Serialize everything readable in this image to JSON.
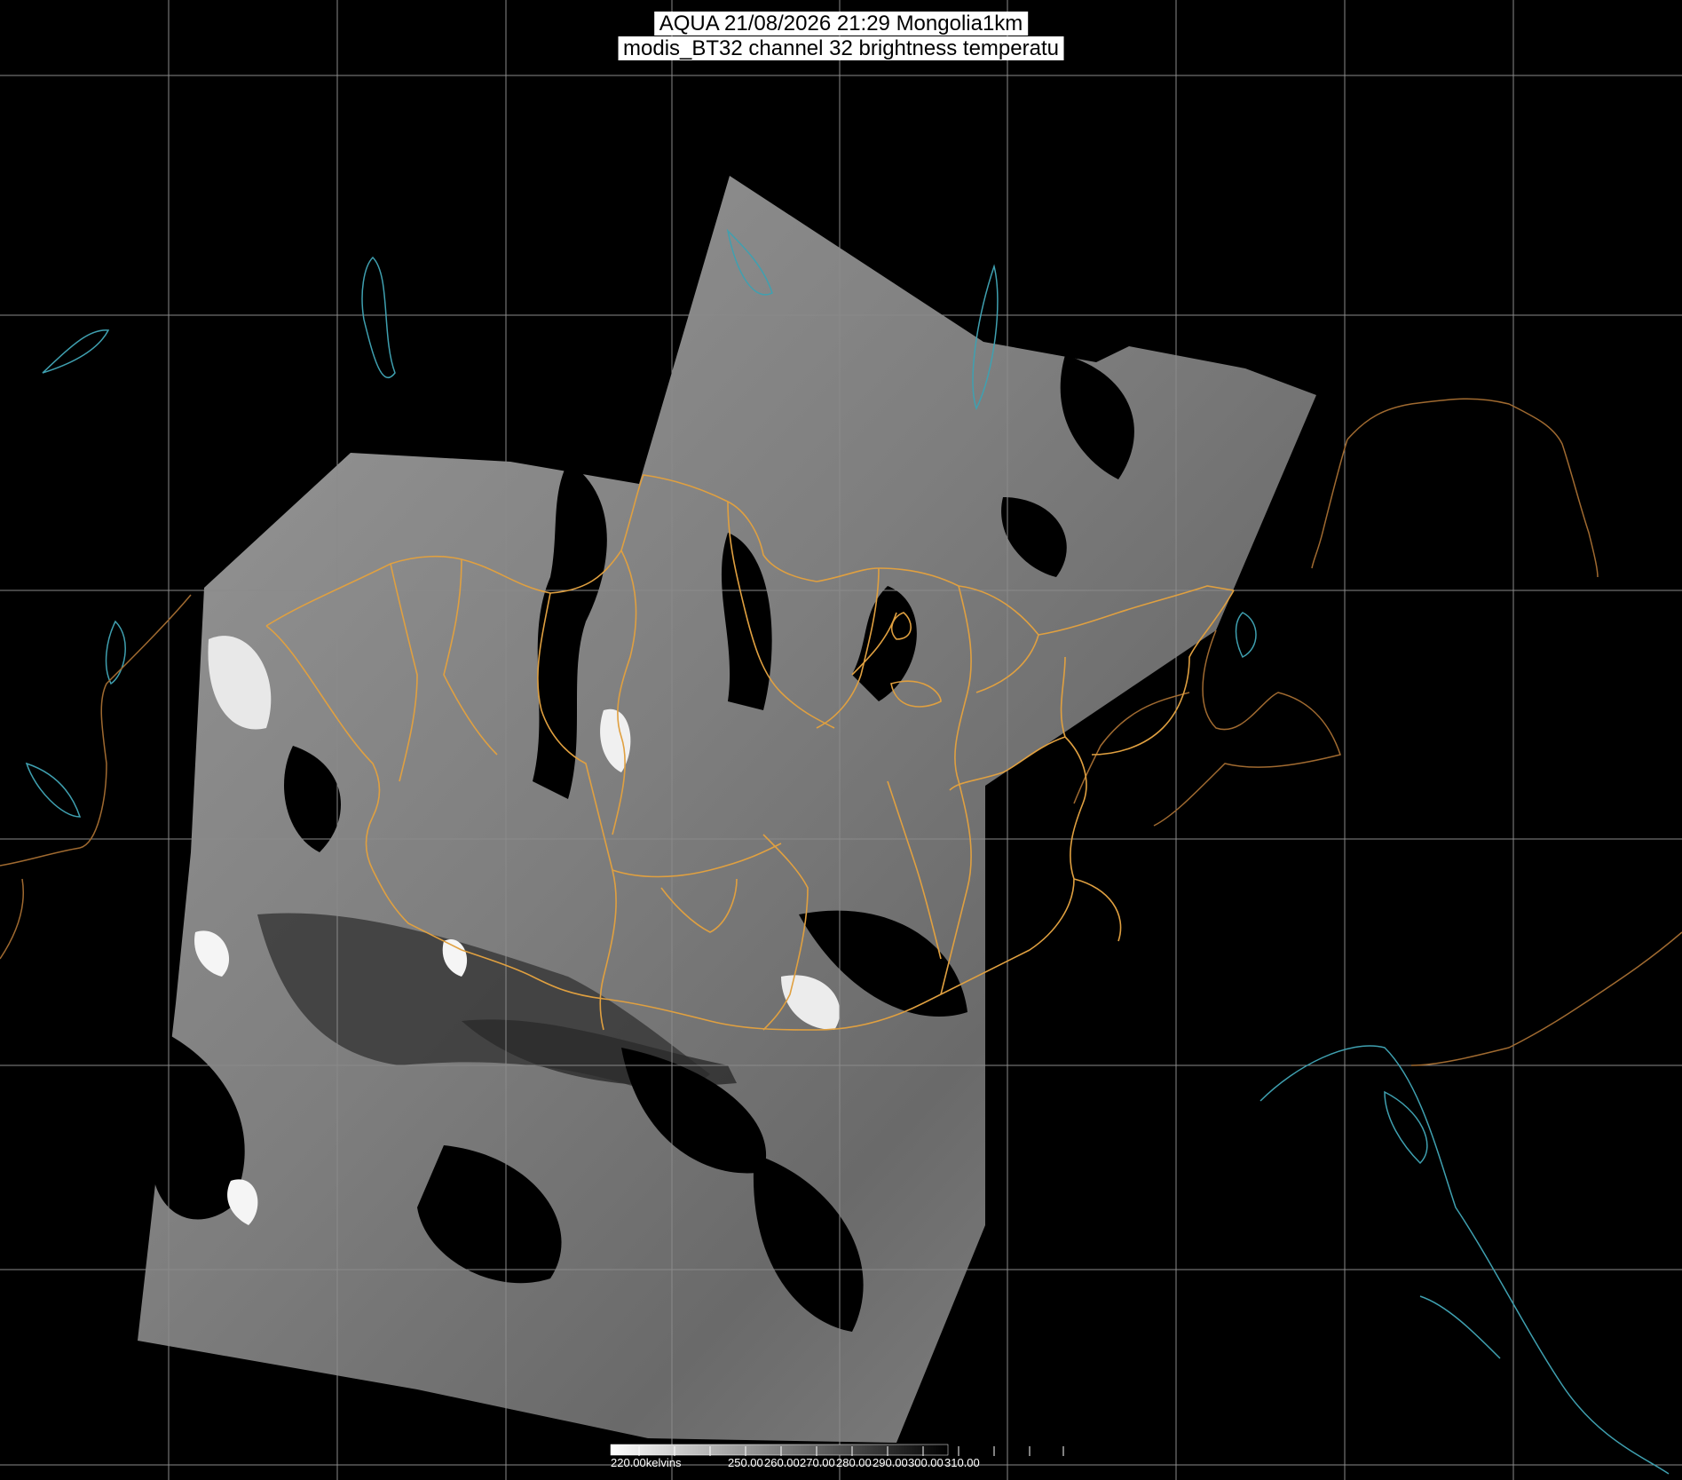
{
  "header": {
    "line1": "AQUA 21/08/2026 21:29 Mongolia1km",
    "line2": "modis_BT32 channel 32 brightness temperatu"
  },
  "colors": {
    "background": "#000000",
    "graticule": "#8a8a8a",
    "province_borders": "#e0a040",
    "country_borders": "#a06a30",
    "coastlines": "#3fa0b0"
  },
  "colorbar": {
    "unit_label": "220.00kelvins",
    "tick_labels": [
      "250.00",
      "260.00",
      "270.00",
      "280.00",
      "290.00",
      "300.00",
      "310.00"
    ],
    "gradient": "white-to-black"
  },
  "image_layer": {
    "product": "modis_BT32",
    "sensor": "AQUA"
  }
}
